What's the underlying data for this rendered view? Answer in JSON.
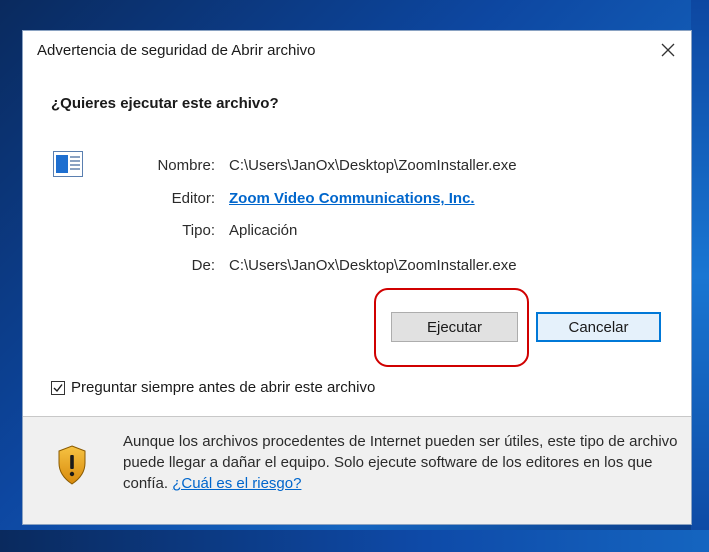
{
  "dialog": {
    "title": "Advertencia de seguridad de Abrir archivo",
    "close_glyph": "✕",
    "question": "¿Quieres ejecutar este archivo?"
  },
  "file_info": {
    "name_label": "Nombre:",
    "name_value": "C:\\Users\\JanOx\\Desktop\\ZoomInstaller.exe",
    "publisher_label": "Editor:",
    "publisher_value": "Zoom Video Communications, Inc.",
    "type_label": "Tipo:",
    "type_value": "Aplicación",
    "from_label": "De:",
    "from_value": "C:\\Users\\JanOx\\Desktop\\ZoomInstaller.exe"
  },
  "buttons": {
    "run_label": "Ejecutar",
    "cancel_label": "Cancelar"
  },
  "checkbox": {
    "label": "Preguntar siempre antes de abrir este archivo",
    "checked": true
  },
  "warning": {
    "text": "Aunque los archivos procedentes de Internet pueden ser útiles, este tipo de archivo puede llegar a dañar el equipo. Solo ejecute software de los editores en los que confía.",
    "link_label": "¿Cuál es el riesgo?"
  },
  "icons": {
    "file": "application-file-icon",
    "shield": "warning-shield-icon",
    "close": "close-icon",
    "checkmark": "checkmark-icon"
  },
  "colors": {
    "link": "#0066cc",
    "highlight": "#d00000",
    "primary_border": "#0078d7",
    "shield": "#e8a317"
  }
}
